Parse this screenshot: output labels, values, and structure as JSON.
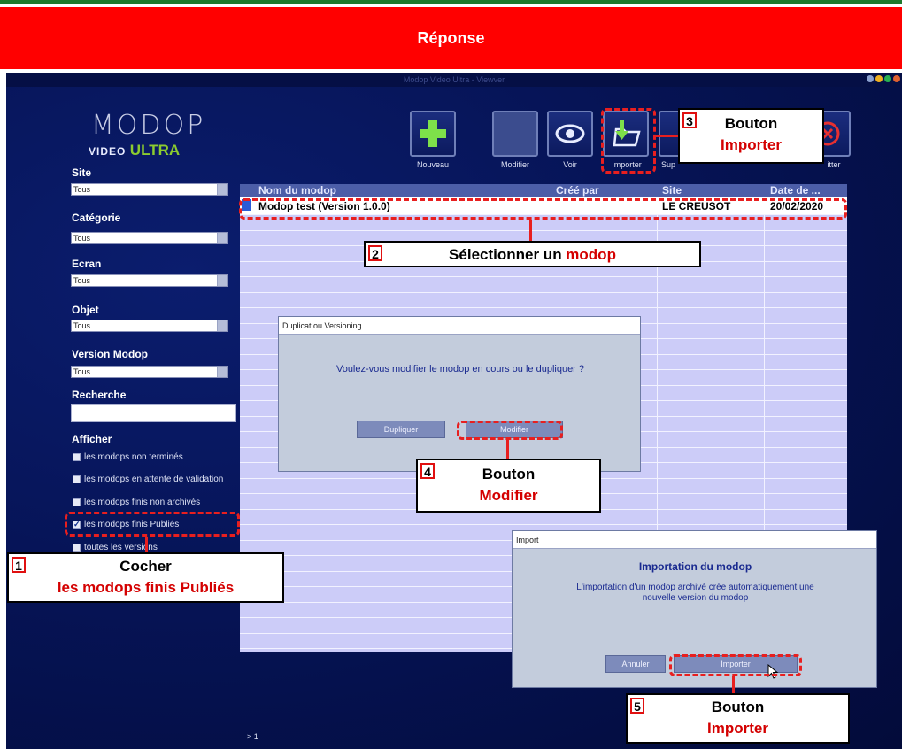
{
  "banner": {
    "title": "Réponse"
  },
  "app": {
    "window_title": "Modop Video Ultra - Viewver"
  },
  "logo": {
    "main": "MODOP",
    "video": "VIDEO",
    "ultra": "ULTRA"
  },
  "sidebar": {
    "site_label": "Site",
    "site_value": "Tous",
    "categorie_label": "Catégorie",
    "categorie_value": "Tous",
    "ecran_label": "Ecran",
    "ecran_value": "Tous",
    "objet_label": "Objet",
    "objet_value": "Tous",
    "version_label": "Version Modop",
    "version_value": "Tous",
    "recherche_label": "Recherche",
    "recherche_value": "",
    "afficher_label": "Afficher",
    "checkboxes": [
      {
        "label": "les modops non terminés",
        "checked": false
      },
      {
        "label": "les modops en attente de validation",
        "checked": false
      },
      {
        "label": "les modops finis non archivés",
        "checked": false
      },
      {
        "label": "les modops finis Publiés",
        "checked": true
      },
      {
        "label": "toutes les versions",
        "checked": false
      }
    ]
  },
  "toolbar": {
    "nouveau": "Nouveau",
    "modifier": "Modifier",
    "voir": "Voir",
    "importer": "Importer",
    "supprimer": "Sup",
    "quitter": "itter"
  },
  "table": {
    "headers": [
      "Nom du modop",
      "Créé par",
      "Site",
      "Date de ..."
    ],
    "rows": [
      {
        "nom": "Modop test (Version 1.0.0)",
        "cree_par": "",
        "site": "LE CREUSOT",
        "date": "20/02/2020"
      }
    ],
    "page": "> 1"
  },
  "dialog_duplicat": {
    "title": "Duplicat ou Versioning",
    "question": "Voulez-vous modifier le modop en cours ou le dupliquer ?",
    "btn_dupliquer": "Dupliquer",
    "btn_modifier": "Modifier"
  },
  "dialog_import": {
    "title": "Import",
    "heading": "Importation du modop",
    "message_line1": "L'importation d'un modop archivé crée automatiquement une",
    "message_line2": "nouvelle version du modop",
    "btn_annuler": "Annuler",
    "btn_importer": "Importer"
  },
  "callouts": {
    "c1": {
      "num": "1",
      "black": "Cocher",
      "red": "les modops finis Publiés"
    },
    "c2": {
      "num": "2",
      "black": "Sélectionner un ",
      "red": "modop"
    },
    "c3": {
      "num": "3",
      "black": "Bouton",
      "red": "Importer"
    },
    "c4": {
      "num": "4",
      "black": "Bouton",
      "red": "Modifier"
    },
    "c5": {
      "num": "5",
      "black": "Bouton",
      "red": "Importer"
    }
  },
  "colors": {
    "banner": "#ff0000",
    "annotation": "#e81f1f",
    "app_bg": "#061457",
    "table_bg": "#ccccf8",
    "header": "#4c5ea8"
  }
}
